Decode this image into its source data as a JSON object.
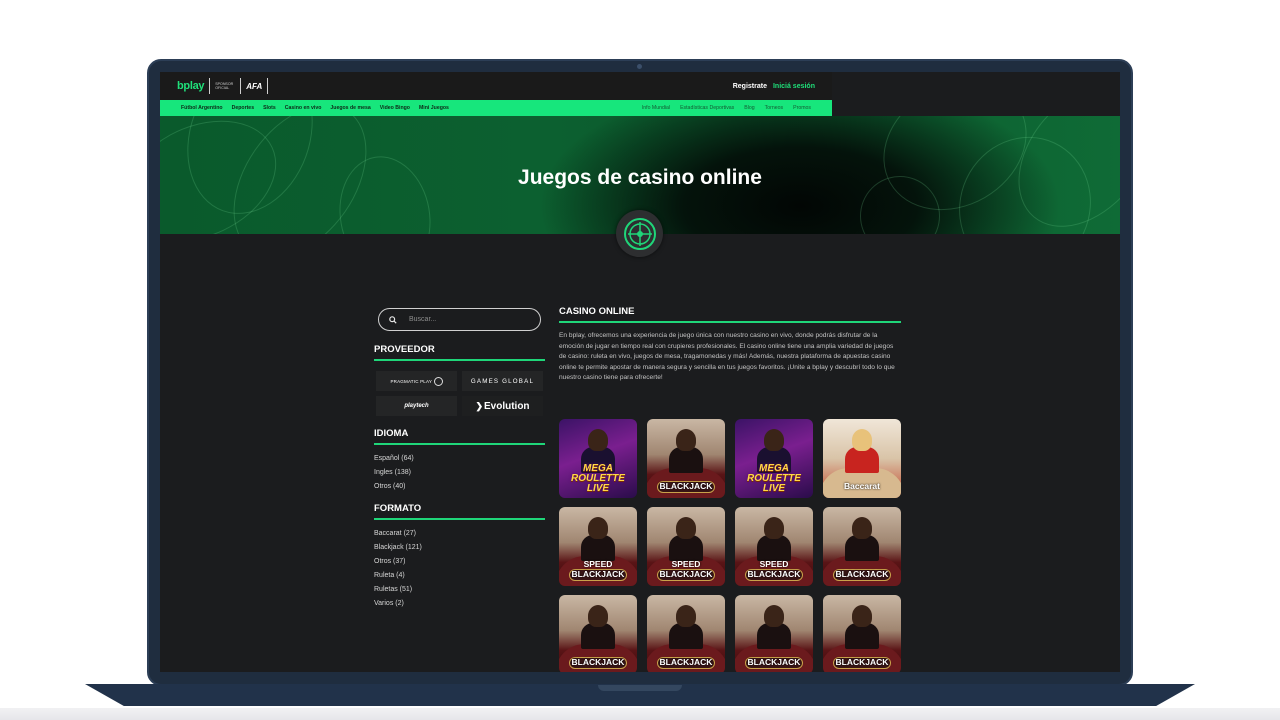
{
  "brand": {
    "logo": "bplay",
    "sponsor": "SPONSOR OFICIAL",
    "partner_logo": "AFA",
    "accent": "#17e67c"
  },
  "auth": {
    "register": "Registrate",
    "login": "Iniciá sesión"
  },
  "nav": {
    "left": [
      "Fútbol Argentino",
      "Deportes",
      "Slots",
      "Casino en vivo",
      "Juegos de mesa",
      "Video Bingo",
      "Mini Juegos"
    ],
    "right": [
      "Info Mundial",
      "Estadísticas Deportivas",
      "Blog",
      "Torneos",
      "Promos"
    ]
  },
  "hero": {
    "title": "Juegos de casino online",
    "badge_icon": "roulette-icon"
  },
  "search": {
    "placeholder": "Buscar...",
    "icon": "search-icon"
  },
  "provider": {
    "title": "PROVEEDOR",
    "items": [
      "PRAGMATIC PLAY",
      "GAMES GLOBAL",
      "playtech",
      "Evolution"
    ]
  },
  "language": {
    "title": "IDIOMA",
    "items": [
      "Español (64)",
      "Ingles (138)",
      "Otros (40)"
    ]
  },
  "format": {
    "title": "FORMATO",
    "items": [
      "Baccarat (27)",
      "Blackjack (121)",
      "Otros (37)",
      "Ruleta (4)",
      "Ruletas (51)",
      "Varios (2)"
    ]
  },
  "main": {
    "title": "CASINO ONLINE",
    "description": "En bplay, ofrecemos una experiencia de juego única con nuestro casino en vivo, donde podrás disfrutar de la emoción de jugar en tiempo real con crupieres profesionales. El casino online tiene una amplia variedad de juegos de casino: ruleta en vivo, juegos de mesa, tragamonedas y más! Además, nuestra plataforma de apuestas casino online te permite apostar de manera segura y sencilla en tus juegos favoritos. ¡Unite a bplay y descubrí todo lo que nuestro casino tiene para ofrecerte!"
  },
  "games": [
    {
      "label": "MEGA ROULETTE LIVE",
      "kind": "roulette"
    },
    {
      "label": "BLACKJACK",
      "kind": "blackjack"
    },
    {
      "label": "MEGA ROULETTE LIVE",
      "kind": "roulette"
    },
    {
      "label": "Baccarat",
      "kind": "baccarat"
    },
    {
      "label": "SPEED BLACKJACK",
      "kind": "blackjack"
    },
    {
      "label": "SPEED BLACKJACK",
      "kind": "blackjack"
    },
    {
      "label": "SPEED BLACKJACK",
      "kind": "blackjack"
    },
    {
      "label": "BLACKJACK",
      "kind": "blackjack"
    },
    {
      "label": "BLACKJACK",
      "kind": "blackjack"
    },
    {
      "label": "BLACKJACK",
      "kind": "blackjack"
    },
    {
      "label": "BLACKJACK",
      "kind": "blackjack"
    },
    {
      "label": "BLACKJACK",
      "kind": "blackjack"
    }
  ]
}
